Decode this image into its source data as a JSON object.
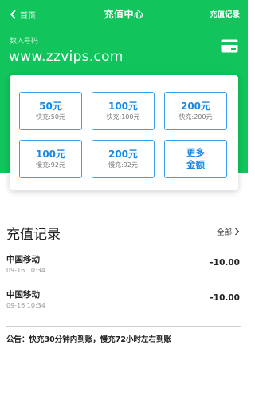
{
  "header": {
    "back_label": "首页",
    "title": "充值中心",
    "records_link": "充值记录",
    "account_label": "数入号码",
    "account_value": "www.zzvips.com",
    "accent_color": "#12c45c"
  },
  "options": [
    {
      "amount": "50元",
      "note": "快充:50元"
    },
    {
      "amount": "100元",
      "note": "快充:100元"
    },
    {
      "amount": "200元",
      "note": "快充:200元"
    },
    {
      "amount": "100元",
      "note": "慢充:92元"
    },
    {
      "amount": "200元",
      "note": "慢充:92元"
    },
    {
      "more_line1": "更多",
      "more_line2": "金额"
    }
  ],
  "records": {
    "title": "充值记录",
    "all_label": "全部",
    "items": [
      {
        "operator": "中国移动",
        "time": "09-16 10:34",
        "amount": "-10.00"
      },
      {
        "operator": "中国移动",
        "time": "09-16 10:34",
        "amount": "-10.00"
      }
    ]
  },
  "notice": "公告：快充30分钟内到账，慢充72小时左右到账",
  "icons": [
    "chevron-left-icon",
    "card-icon",
    "chevron-right-icon"
  ]
}
